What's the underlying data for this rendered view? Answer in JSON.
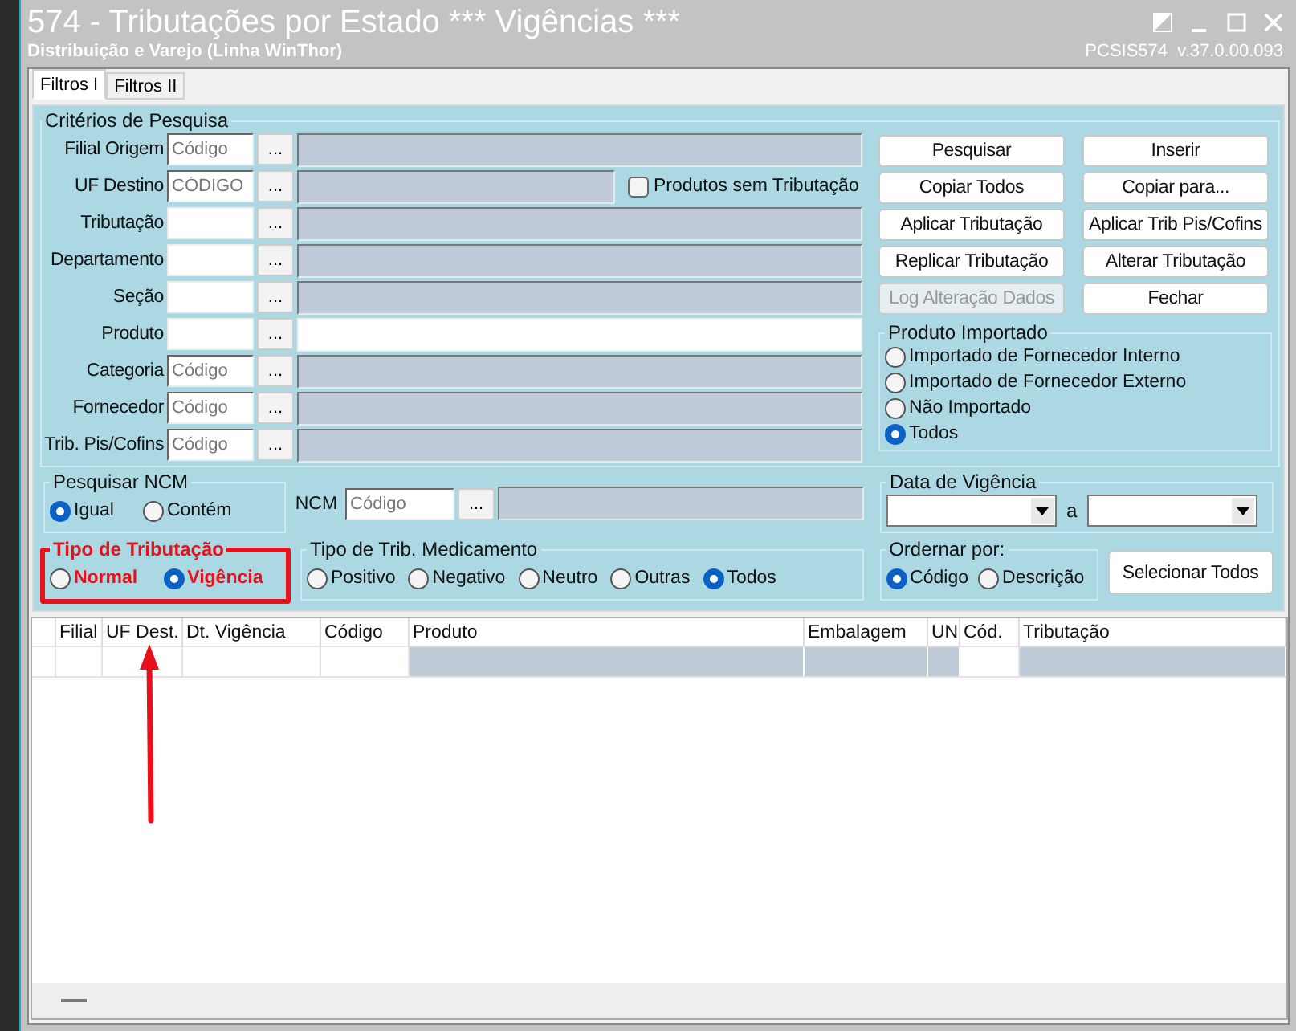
{
  "window": {
    "title": "574 - Tributações por Estado *** Vigências ***",
    "subtitle": "Distribuição e Varejo (Linha WinThor)",
    "version": "PCSIS574  v.37.0.00.093"
  },
  "tabs": [
    {
      "label": "Filtros I",
      "selected": true
    },
    {
      "label": "Filtros II",
      "selected": false
    }
  ],
  "criteria": {
    "title": "Critérios de Pesquisa",
    "fields": [
      {
        "label": "Filial Origem",
        "placeholder": "Código",
        "button": "...",
        "description_enabled": false
      },
      {
        "label": "UF Destino",
        "placeholder": "CÓDIGO",
        "button": "...",
        "description_enabled": false
      },
      {
        "label": "Tributação",
        "button": "...",
        "description_enabled": false
      },
      {
        "label": "Departamento",
        "button": "...",
        "description_enabled": false
      },
      {
        "label": "Seção",
        "button": "...",
        "description_enabled": false
      },
      {
        "label": "Produto",
        "button": "...",
        "description_enabled": true
      },
      {
        "label": "Categoria",
        "placeholder": "Código",
        "button": "...",
        "description_enabled": false
      },
      {
        "label": "Fornecedor",
        "placeholder": "Código",
        "button": "...",
        "description_enabled": false
      },
      {
        "label": "Trib. Pis/Cofins",
        "placeholder": "Código",
        "button": "...",
        "description_enabled": false
      }
    ]
  },
  "no_tax_products": {
    "label": "Produtos sem Tributação",
    "checked": false
  },
  "actions": [
    {
      "label": "Pesquisar",
      "disabled": false
    },
    {
      "label": "Inserir",
      "disabled": false
    },
    {
      "label": "Copiar Todos",
      "disabled": false
    },
    {
      "label": "Copiar para...",
      "disabled": false
    },
    {
      "label": "Aplicar Tributação",
      "disabled": false
    },
    {
      "label": "Aplicar Trib Pis/Cofins",
      "disabled": false
    },
    {
      "label": "Replicar Tributação",
      "disabled": false
    },
    {
      "label": "Alterar Tributação",
      "disabled": false
    },
    {
      "label": "Log Alteração Dados",
      "disabled": true
    },
    {
      "label": "Fechar",
      "disabled": false
    }
  ],
  "imported_product": {
    "title": "Produto Importado",
    "options": [
      {
        "label": "Importado de Fornecedor Interno",
        "selected": false
      },
      {
        "label": "Importado de Fornecedor Externo",
        "selected": false
      },
      {
        "label": "Não Importado",
        "selected": false
      },
      {
        "label": "Todos",
        "selected": true
      }
    ]
  },
  "ncm_search": {
    "title": "Pesquisar NCM",
    "options": [
      {
        "label": "Igual",
        "selected": true
      },
      {
        "label": "Contém",
        "selected": false
      }
    ]
  },
  "ncm": {
    "label": "NCM",
    "placeholder": "Código",
    "button": "..."
  },
  "validity_date": {
    "title": "Data de Vigência",
    "separator": "a"
  },
  "tax_type": {
    "title": "Tipo de Tributação",
    "highlighted": true,
    "options": [
      {
        "label": "Normal",
        "selected": false
      },
      {
        "label": "Vigência",
        "selected": true
      }
    ]
  },
  "medicine_tax_type": {
    "title": "Tipo de Trib. Medicamento",
    "options": [
      {
        "label": "Positivo",
        "selected": false
      },
      {
        "label": "Negativo",
        "selected": false
      },
      {
        "label": "Neutro",
        "selected": false
      },
      {
        "label": "Outras",
        "selected": false
      },
      {
        "label": "Todos",
        "selected": true
      }
    ]
  },
  "order_by": {
    "title": "Ordernar por:",
    "options": [
      {
        "label": "Código",
        "selected": true
      },
      {
        "label": "Descrição",
        "selected": false
      }
    ]
  },
  "select_all_button": "Selecionar Todos",
  "table": {
    "columns": [
      {
        "label": "Filial",
        "shaded": false
      },
      {
        "label": "UF Dest.",
        "shaded": false
      },
      {
        "label": "Dt. Vigência",
        "shaded": false
      },
      {
        "label": "Código",
        "shaded": false
      },
      {
        "label": "Produto",
        "shaded": true
      },
      {
        "label": "Embalagem",
        "shaded": true
      },
      {
        "label": "UN",
        "shaded": true
      },
      {
        "label": "Cód.",
        "shaded": false
      },
      {
        "label": "Tributação",
        "shaded": true
      }
    ]
  }
}
